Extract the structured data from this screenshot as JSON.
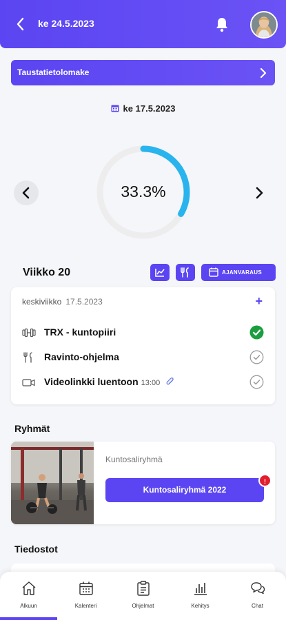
{
  "header": {
    "title": "ke 24.5.2023",
    "back_icon": "chevron-left-icon",
    "bell_icon": "bell-icon"
  },
  "banner": {
    "label": "Taustatietolomake"
  },
  "selected_date": "ke 17.5.2023",
  "progress": {
    "percent_label": "33.3%",
    "value": 0.333,
    "ring_color": "#29b4ee",
    "track_color": "#ededed"
  },
  "week": {
    "title": "Viikko 20",
    "booking_label": "AJANVARAUS"
  },
  "day_card": {
    "weekday": "keskiviikko",
    "date": "17.5.2023",
    "add_label": "+",
    "tasks": [
      {
        "label": "TRX - kuntopiiri",
        "time": "",
        "done": true,
        "icon": "dumbbell-icon"
      },
      {
        "label": "Ravinto-ohjelma",
        "time": "",
        "done": false,
        "icon": "cutlery-icon"
      },
      {
        "label": "Videolinkki luentoon",
        "time": "13:00",
        "done": false,
        "icon": "video-icon"
      }
    ]
  },
  "groups": {
    "title": "Ryhmät",
    "card_name": "Kuntosaliryhmä",
    "button_label": "Kuntosaliryhmä 2022",
    "badge": "!"
  },
  "files": {
    "title": "Tiedostot"
  },
  "tabs": [
    {
      "label": "Alkuun",
      "active": true
    },
    {
      "label": "Kalenteri",
      "active": false
    },
    {
      "label": "Ohjelmat",
      "active": false
    },
    {
      "label": "Kehitys",
      "active": false
    },
    {
      "label": "Chat",
      "active": false
    }
  ],
  "colors": {
    "brand": "#5b45f2",
    "success": "#1a9e3f",
    "badge": "#e11d2e"
  }
}
